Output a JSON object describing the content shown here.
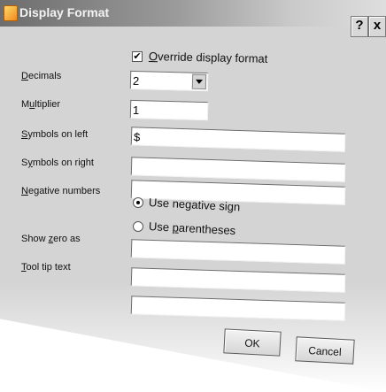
{
  "window": {
    "title": "Display Format",
    "help_label": "?",
    "close_label": "x"
  },
  "form": {
    "override": {
      "checked": true,
      "mark": "✔",
      "prefix": "",
      "accel": "O",
      "suffix": "verride display format"
    },
    "decimals": {
      "accel": "D",
      "rest": "ecimals",
      "value": "2"
    },
    "multiplier": {
      "prefix": "M",
      "accel": "u",
      "rest": "ltiplier",
      "value": "1"
    },
    "symbols_left": {
      "accel": "S",
      "rest": "ymbols on left",
      "value": "$"
    },
    "symbols_right": {
      "prefix": "S",
      "accel": "y",
      "rest": "mbols on right",
      "value": ""
    },
    "negative": {
      "accel": "N",
      "rest": "egative numbers",
      "option_sign": {
        "prefix": "Use ne",
        "accel": "g",
        "suffix": "ative sign",
        "selected": true
      },
      "option_paren": {
        "prefix": "Use ",
        "accel": "p",
        "suffix": "arentheses",
        "selected": false
      },
      "field_value": ""
    },
    "show_zero": {
      "prefix": "Show ",
      "accel": "z",
      "rest": "ero as",
      "value": ""
    },
    "tooltip": {
      "accel": "T",
      "rest": "ool tip text",
      "value": "",
      "value2": ""
    }
  },
  "buttons": {
    "ok": "OK",
    "cancel": "Cancel"
  }
}
